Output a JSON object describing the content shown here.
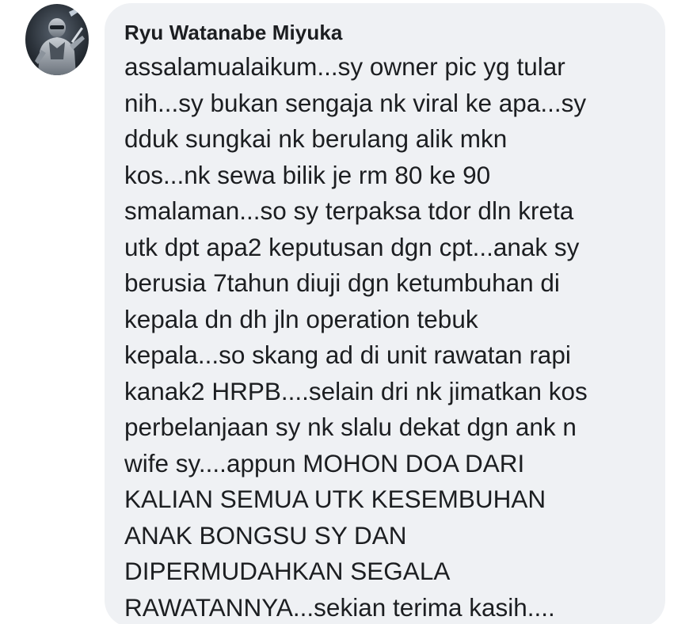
{
  "comment": {
    "author": "Ryu Watanabe Miyuka",
    "avatar_icon": "armored-figure-avatar",
    "lines": [
      "assalamualaikum...sy owner pic yg tular",
      "nih...sy bukan sengaja nk viral ke apa...sy",
      "dduk sungkai nk berulang alik mkn",
      "kos...nk sewa bilik je rm 80 ke 90",
      "smalaman...so sy terpaksa tdor dln kreta",
      "utk dpt apa2 keputusan dgn cpt...anak sy",
      "berusia 7tahun diuji dgn ketumbuhan di",
      "kepala dn dh jln operation tebuk",
      "kepala...so skang ad di unit rawatan rapi",
      "kanak2 HRPB....selain dri nk jimatkan kos",
      "perbelanjaan sy nk slalu dekat dgn ank n",
      "wife sy....appun MOHON DOA DARI",
      "KALIAN SEMUA UTK KESEMBUHAN",
      "ANAK BONGSU SY DAN",
      "DIPERMUDAHKAN SEGALA",
      "RAWATANNYA...sekian terima kasih...."
    ]
  },
  "colors": {
    "bubble_bg": "#eff1f4",
    "text": "#1c1e21",
    "page_bg": "#ffffff"
  }
}
